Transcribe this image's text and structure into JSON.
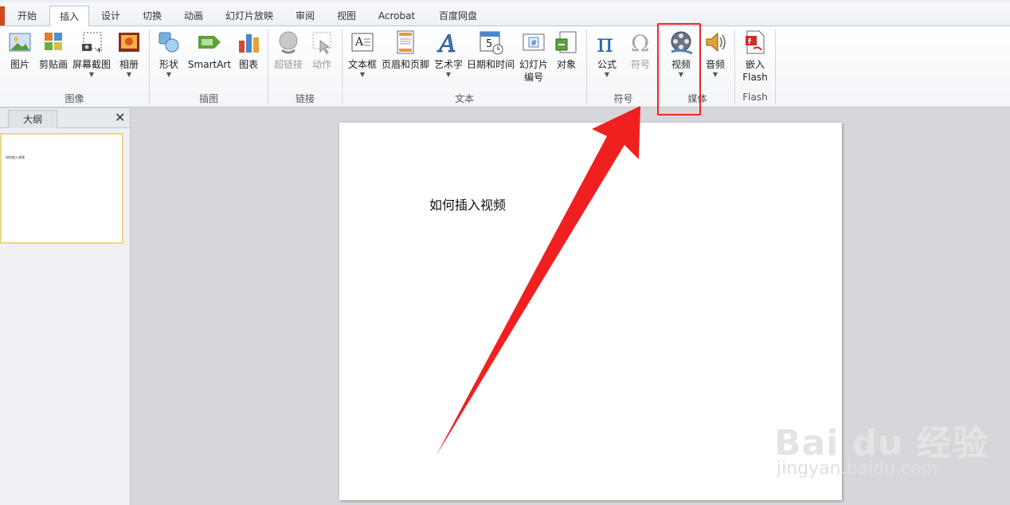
{
  "tabs": [
    "开始",
    "插入",
    "设计",
    "切换",
    "动画",
    "幻灯片放映",
    "审阅",
    "视图",
    "Acrobat",
    "百度网盘"
  ],
  "active_tab": "插入",
  "ribbon": {
    "groups": [
      "图像",
      "插图",
      "链接",
      "文本",
      "符号",
      "媒体",
      "Flash"
    ],
    "buttons": {
      "picture": "图片",
      "clipart": "剪贴画",
      "screenshot": "屏幕截图",
      "album": "相册",
      "shapes": "形状",
      "smartart": "SmartArt",
      "chart": "图表",
      "hyperlink": "超链接",
      "action": "动作",
      "textbox": "文本框",
      "header_footer": "页眉和页脚",
      "wordart": "艺术字",
      "datetime": "日期和时间",
      "slide_number_1": "幻灯片",
      "slide_number_2": "编号",
      "object": "对象",
      "equation": "公式",
      "symbol": "符号",
      "video": "视频",
      "audio": "音频",
      "embed_flash_1": "嵌入",
      "embed_flash_2": "Flash"
    }
  },
  "side_panel": {
    "tab": "大纲",
    "close": "✕",
    "thumb_text": "如何插入视频"
  },
  "slide": {
    "text": "如何插入视频"
  },
  "watermark": {
    "line1": "Bai du 经验",
    "line2": "jingyan.baidu.com"
  },
  "colors": {
    "accent_red": "#e8282a",
    "file_tab": "#d04a1b"
  }
}
